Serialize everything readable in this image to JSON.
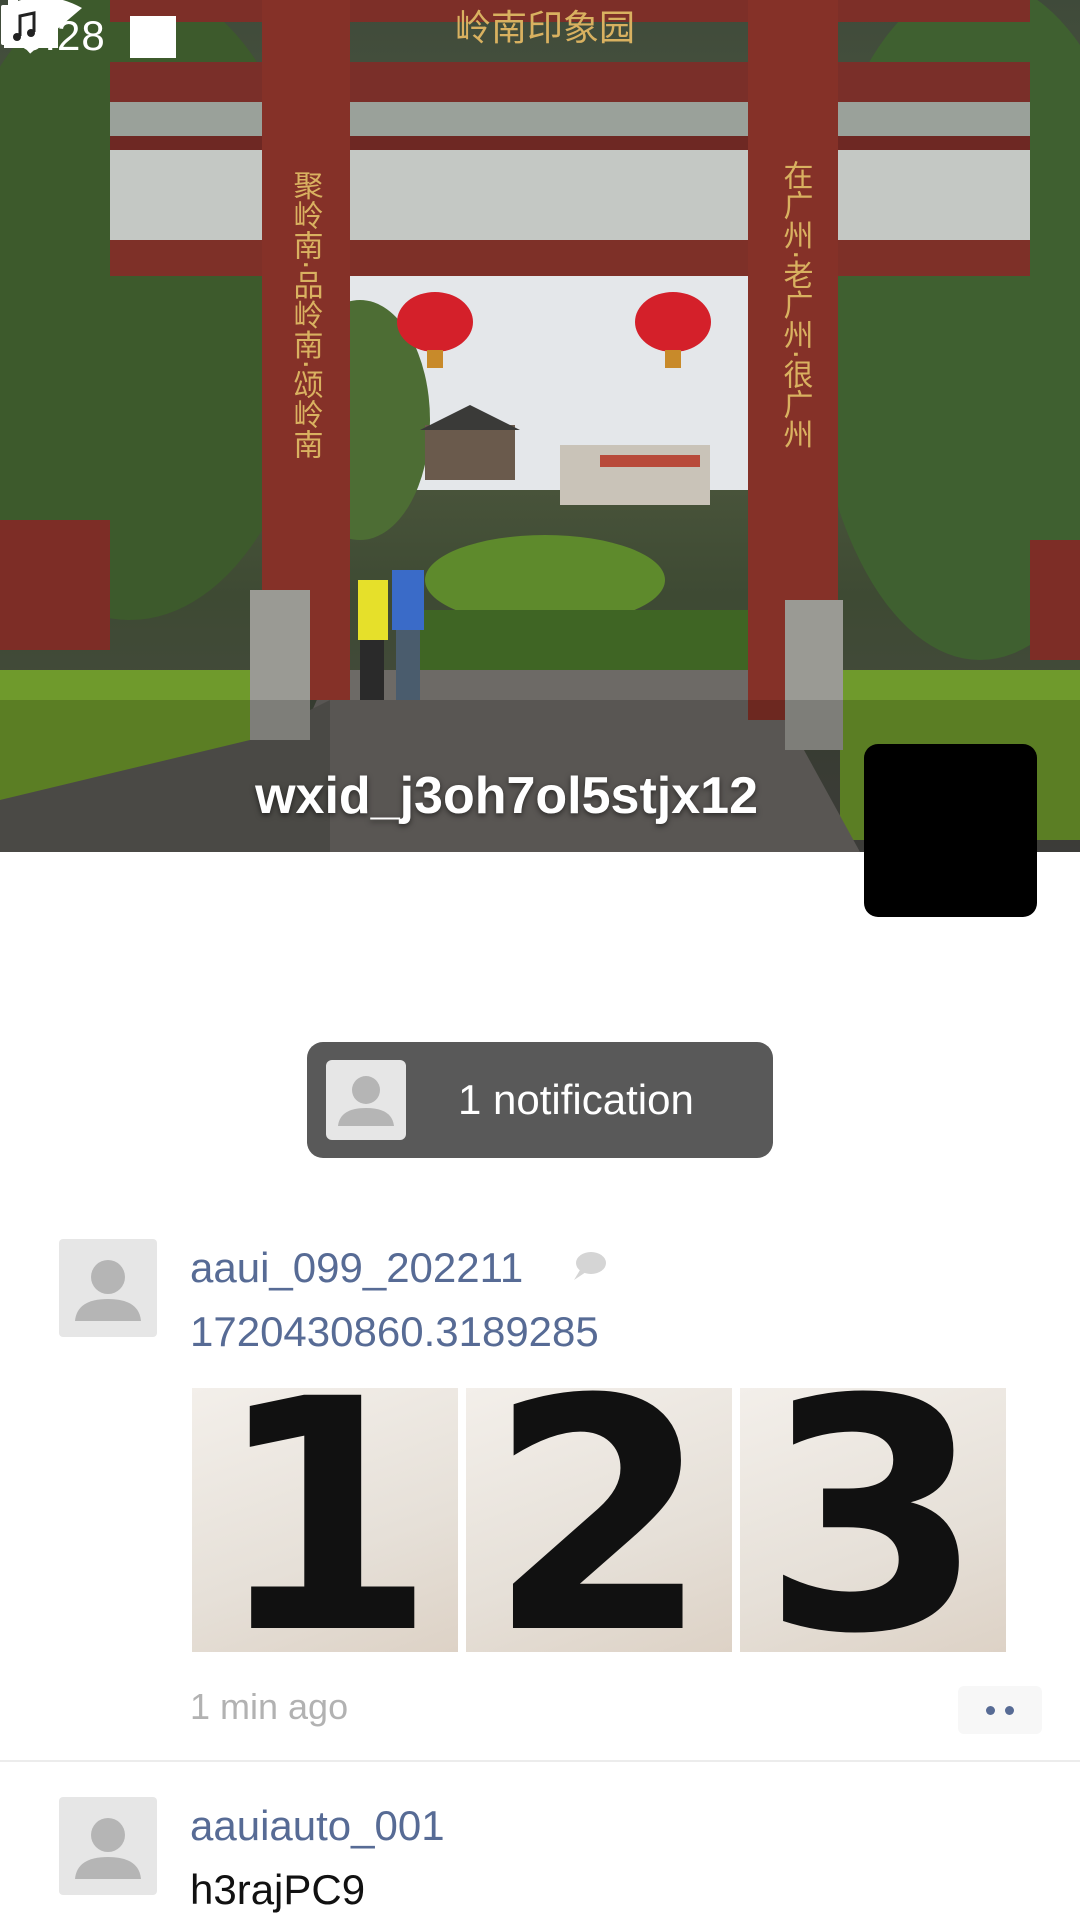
{
  "status_bar": {
    "time": "5:28"
  },
  "cover": {
    "gate_title": "岭南印象园",
    "left_pillar_text": "聚岭南·品岭南·颂岭南",
    "right_pillar_text": "在广州·老广州·很广州"
  },
  "header": {
    "back_icon": "chevron-left-icon",
    "camera_icon": "camera-icon"
  },
  "profile": {
    "name": "wxid_j3oh7ol5stjx12",
    "music_icon": "music-note-icon"
  },
  "notification": {
    "text": "1 notification"
  },
  "posts": [
    {
      "username": "aaui_099_202211",
      "text": "1720430860.3189285",
      "photos": [
        "1",
        "2",
        "3"
      ],
      "time": "1 min ago"
    },
    {
      "username": "aauiauto_001",
      "text": "h3rajPC9"
    }
  ],
  "colors": {
    "link": "#576b95",
    "pill": "#595959",
    "time": "#b2b2b2"
  }
}
